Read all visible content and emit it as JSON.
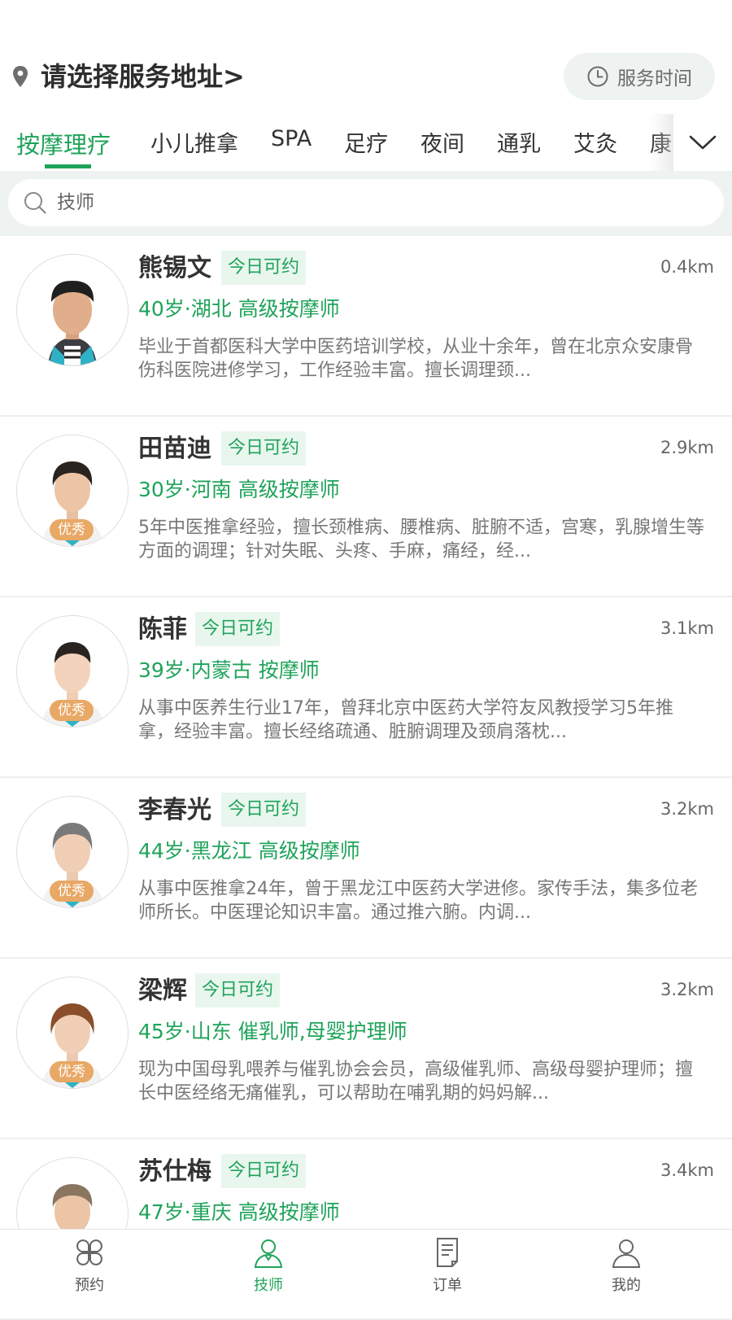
{
  "header": {
    "address": "请选择服务地址>",
    "service_time": "服务时间"
  },
  "tabs": [
    {
      "label": "按摩理疗",
      "active": true
    },
    {
      "label": "小儿推拿"
    },
    {
      "label": "SPA"
    },
    {
      "label": "足疗"
    },
    {
      "label": "夜间"
    },
    {
      "label": "通乳"
    },
    {
      "label": "艾灸"
    },
    {
      "label": "康"
    }
  ],
  "search": {
    "placeholder": "技师"
  },
  "therapists": [
    {
      "name": "熊锡文",
      "status": "今日可约",
      "distance": "0.4km",
      "meta": "40岁·湖北 高级按摩师",
      "badge": "",
      "desc": "毕业于首都医科大学中医药培训学校，从业十余年，曾在北京众安康骨伤科医院进修学习，工作经验丰富。擅长调理颈..."
    },
    {
      "name": "田苗迪",
      "status": "今日可约",
      "distance": "2.9km",
      "meta": "30岁·河南 高级按摩师",
      "badge": "优秀",
      "desc": "5年中医推拿经验，擅长颈椎病、腰椎病、脏腑不适，宫寒，乳腺增生等方面的调理；针对失眠、头疼、手麻，痛经，经..."
    },
    {
      "name": "陈菲",
      "status": "今日可约",
      "distance": "3.1km",
      "meta": "39岁·内蒙古 按摩师",
      "badge": "优秀",
      "desc": "从事中医养生行业17年，曾拜北京中医药大学符友风教授学习5年推拿，经验丰富。擅长经络疏通、脏腑调理及颈肩落枕..."
    },
    {
      "name": "李春光",
      "status": "今日可约",
      "distance": "3.2km",
      "meta": "44岁·黑龙江 高级按摩师",
      "badge": "优秀",
      "desc": "从事中医推拿24年，曾于黑龙江中医药大学进修。家传手法，集多位老师所长。中医理论知识丰富。通过推六腑。内调..."
    },
    {
      "name": "梁辉",
      "status": "今日可约",
      "distance": "3.2km",
      "meta": "45岁·山东 催乳师,母婴护理师",
      "badge": "优秀",
      "desc": "现为中国母乳喂养与催乳协会会员，高级催乳师、高级母婴护理师；擅长中医经络无痛催乳，可以帮助在哺乳期的妈妈解..."
    },
    {
      "name": "苏仕梅",
      "status": "今日可约",
      "distance": "3.4km",
      "meta": "47岁·重庆 高级按摩师",
      "badge": "",
      "desc": ""
    }
  ],
  "bottom_nav": [
    {
      "label": "预约",
      "icon": "clover-icon"
    },
    {
      "label": "技师",
      "icon": "technician-icon",
      "active": true
    },
    {
      "label": "订单",
      "icon": "order-icon"
    },
    {
      "label": "我的",
      "icon": "profile-icon"
    }
  ],
  "colors": {
    "accent": "#1fa35a",
    "badge": "#e8a866",
    "search_bg": "#eef3f1"
  }
}
